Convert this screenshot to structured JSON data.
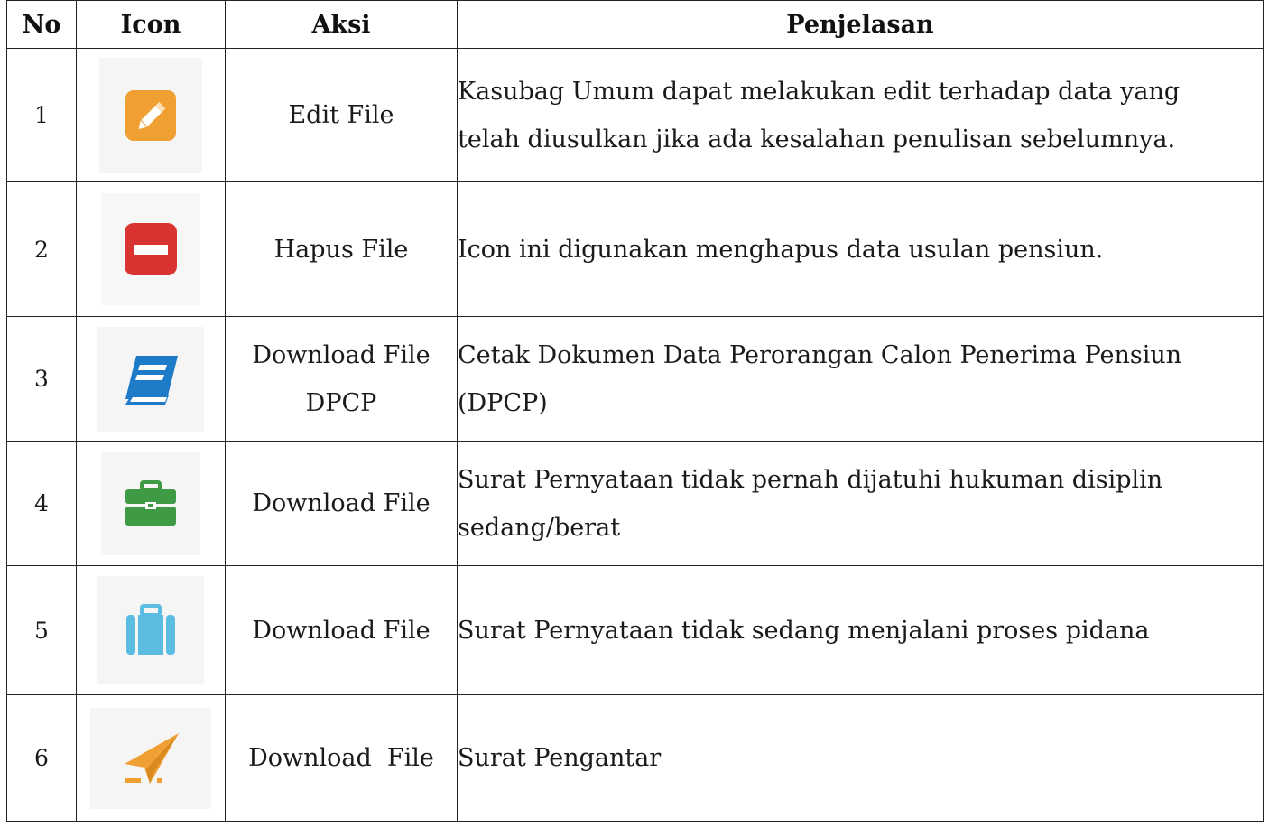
{
  "table": {
    "headers": {
      "no": "No",
      "icon": "Icon",
      "aksi": "Aksi",
      "penjelasan": "Penjelasan"
    },
    "rows": [
      {
        "no": "1",
        "icon": "edit-pencil-icon",
        "icon_color": "#f0a033",
        "aksi": [
          "Edit File"
        ],
        "penjelasan": [
          "Kasubag Umum dapat melakukan edit terhadap data yang",
          "telah diusulkan jika ada kesalahan penulisan sebelumnya."
        ]
      },
      {
        "no": "2",
        "icon": "delete-minus-icon",
        "icon_color": "#d93432",
        "aksi": [
          "Hapus File"
        ],
        "penjelasan": [
          "Icon ini digunakan menghapus data usulan pensiun."
        ]
      },
      {
        "no": "3",
        "icon": "book-icon",
        "icon_color": "#1e7bc8",
        "aksi": [
          "Download File",
          "DPCP"
        ],
        "penjelasan": [
          "Cetak Dokumen Data Perorangan Calon Penerima Pensiun",
          "(DPCP)"
        ]
      },
      {
        "no": "4",
        "icon": "briefcase-icon",
        "icon_color": "#3f9a46",
        "aksi": [
          "Download File"
        ],
        "penjelasan": [
          "Surat Pernyataan tidak pernah dijatuhi hukuman disiplin",
          "sedang/berat"
        ]
      },
      {
        "no": "5",
        "icon": "suitcase-icon",
        "icon_color": "#5bbde2",
        "aksi": [
          "Download File"
        ],
        "penjelasan": [
          "Surat Pernyataan tidak sedang menjalani proses pidana"
        ]
      },
      {
        "no": "6",
        "icon": "paper-plane-icon",
        "icon_color": "#f0a033",
        "aksi": [
          "Download  File"
        ],
        "penjelasan": [
          "Surat Pengantar"
        ]
      }
    ]
  }
}
